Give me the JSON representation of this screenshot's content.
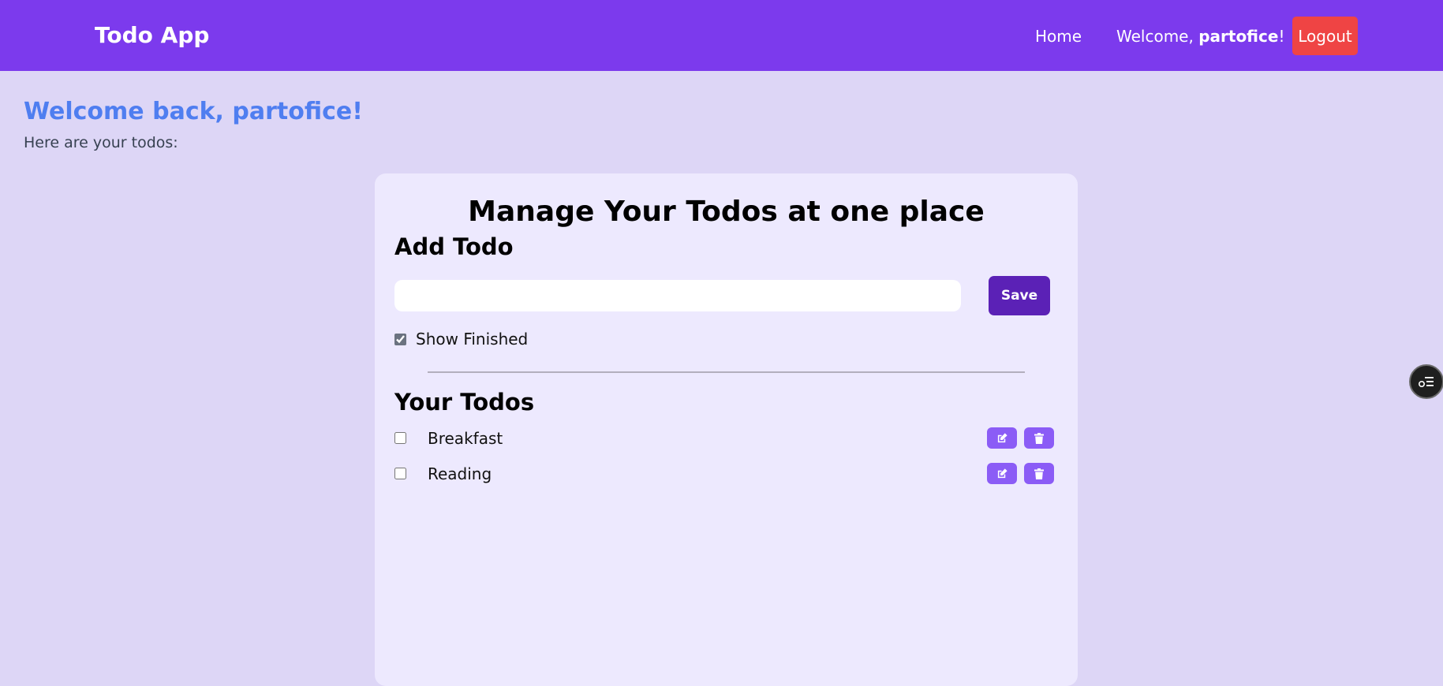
{
  "navbar": {
    "brand": "Todo App",
    "home_label": "Home",
    "welcome_prefix": "Welcome, ",
    "username": "partofice",
    "welcome_suffix": "!",
    "logout_label": "Logout",
    "bg_color": "#7c3aed"
  },
  "greeting": {
    "heading": "Welcome back, partofice!",
    "subtext": "Here are your todos:"
  },
  "card": {
    "title": "Manage Your Todos at one place",
    "add_heading": "Add Todo",
    "input_value": "",
    "save_label": "Save",
    "show_finished_label": "Show Finished",
    "show_finished_checked": true,
    "todos_heading": "Your Todos",
    "todos": [
      {
        "text": "Breakfast",
        "done": false
      },
      {
        "text": "Reading",
        "done": false
      }
    ]
  },
  "icons": {
    "edit": "edit-icon",
    "delete": "trash-icon",
    "widget": "assistant-widget-icon"
  },
  "colors": {
    "accent": "#7c3aed",
    "logout": "#ef4444",
    "save": "#5b21b6",
    "action_button": "#8b5cf6",
    "welcome_heading": "#4f7ef0"
  }
}
